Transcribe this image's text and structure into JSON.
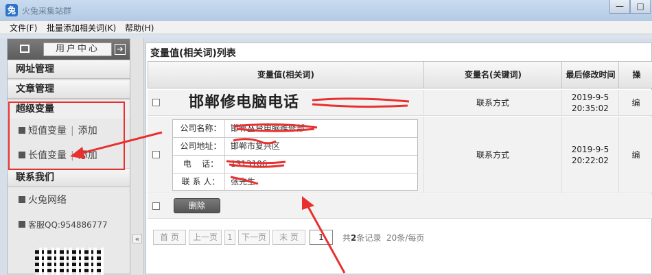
{
  "window": {
    "title": "火兔采集站群",
    "app_icon": "兔",
    "controls": [
      "—",
      "□",
      "✕"
    ]
  },
  "menu": [
    {
      "label": "文件(F)"
    },
    {
      "label": "批量添加相关词(K)"
    },
    {
      "label": "帮助(H)"
    }
  ],
  "sidebar": {
    "user_center": "用户中心",
    "arrow": "➔",
    "sections": {
      "url_mgmt": "网址管理",
      "article_mgmt": "文章管理",
      "super_var": "超级变量",
      "contact": "联系我们"
    },
    "short_var": "短值变量",
    "long_var": "长值变量",
    "add": "添加",
    "separator": "|",
    "firm": "火兔网络",
    "service": "客服QQ:954886777",
    "collapse": "«"
  },
  "main": {
    "title": "变量值(相关词)列表",
    "headers": {
      "value": "变量值(相关词)",
      "name": "变量名(关键词)",
      "modified": "最后修改时间",
      "op": "操"
    },
    "rows": [
      {
        "value": "邯郸修电脑电话",
        "name": "联系方式",
        "time": "2019-9-5 20:35:02",
        "op": "编"
      },
      {
        "fields": [
          {
            "label": "公司名称：",
            "value": "邯郸丛台电脑维修部"
          },
          {
            "label": "公司地址：",
            "value": "邯郸市复兴区"
          },
          {
            "label": "电    话：",
            "value": "1313106"
          },
          {
            "label": "联 系 人：",
            "value": "张先生"
          }
        ],
        "name": "联系方式",
        "time": "2019-9-5 20:22:02",
        "op": "编"
      }
    ],
    "delete_btn": "删除",
    "pager": {
      "first": "首 页",
      "prev": "上一页",
      "current": "1",
      "next": "下一页",
      "last": "末 页",
      "page_input": "1",
      "total_prefix": "共",
      "total": "2",
      "total_suffix": "条记录",
      "per_page": "20条/每页"
    }
  },
  "colors": {
    "annotation": "#e8302f",
    "sidebar_header": "#6a6a6a"
  }
}
